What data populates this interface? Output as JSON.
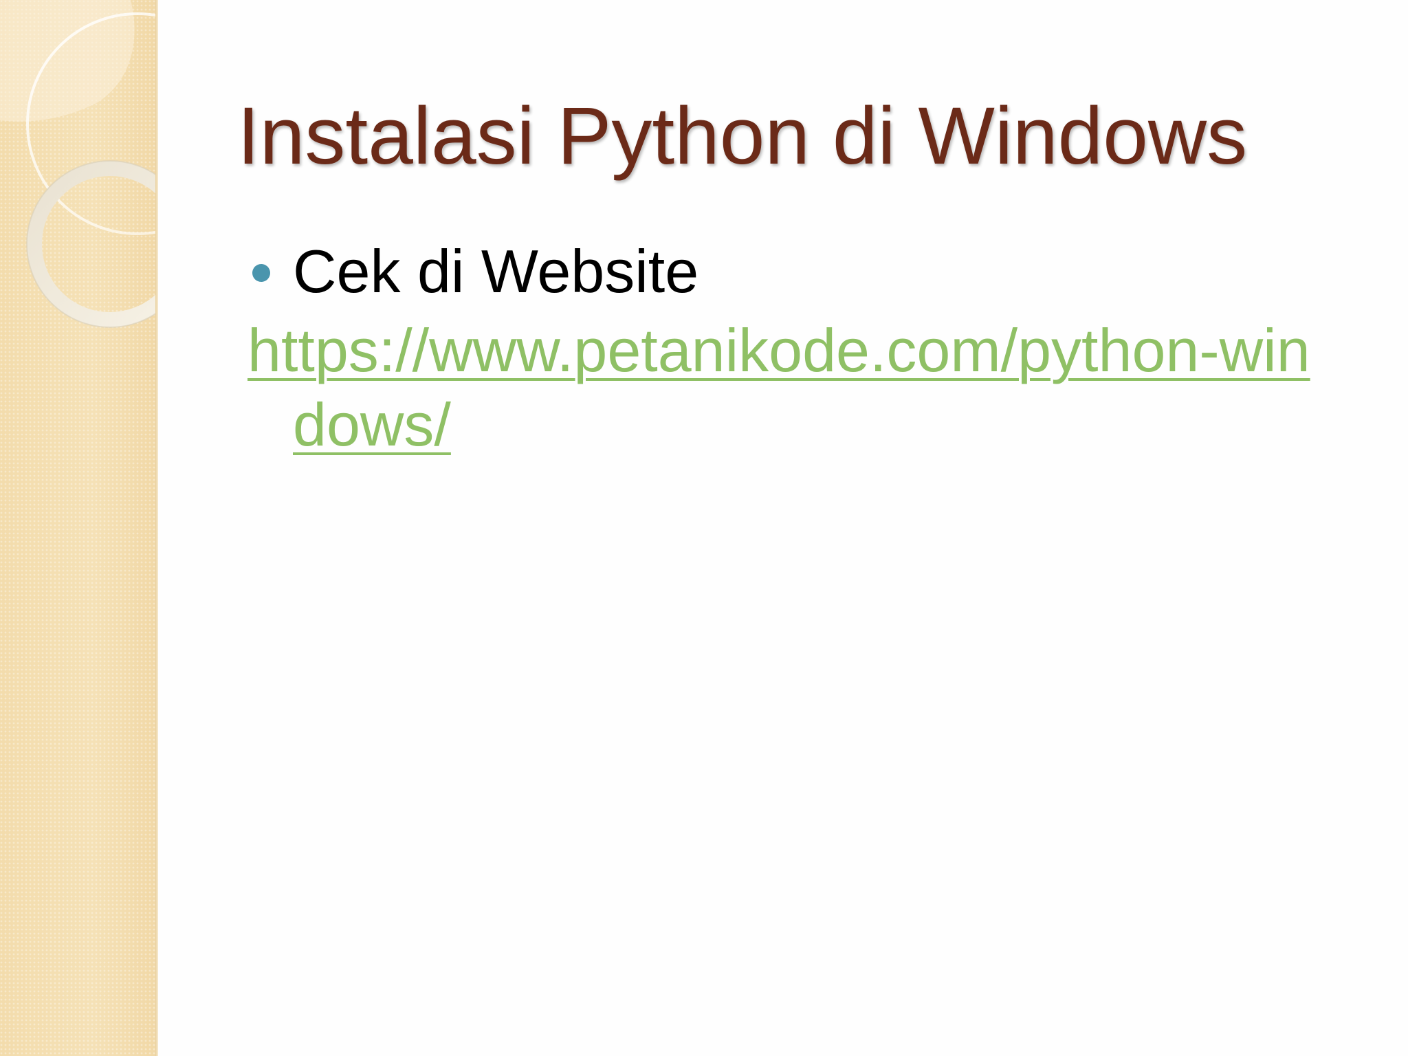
{
  "slide": {
    "title": "Instalasi Python di Windows",
    "bullets": [
      {
        "text": "Cek di Website"
      }
    ],
    "link": {
      "text": "https://www.petanikode.com/python-windows/"
    }
  },
  "colors": {
    "title": "#6b2a18",
    "bullet_dot": "#4a95ad",
    "link": "#8fc065",
    "side_panel": "#f4deb0"
  },
  "icons": {
    "bullet": "bullet-dot-icon"
  }
}
